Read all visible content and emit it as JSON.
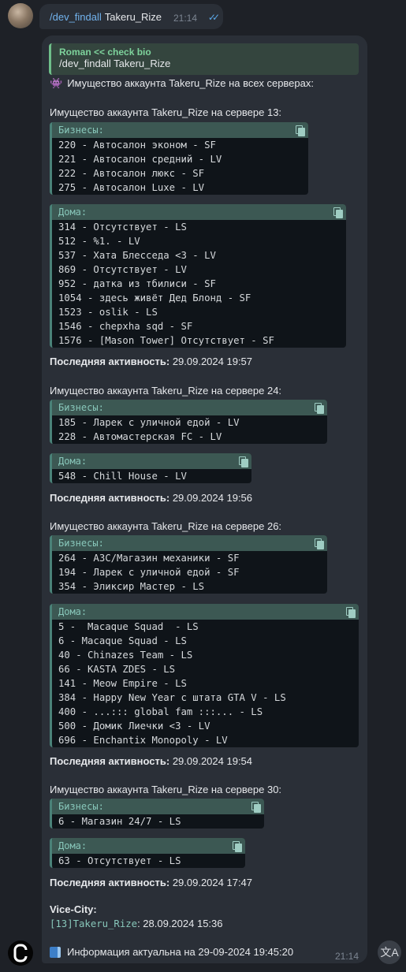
{
  "command": {
    "link": "/dev_findall",
    "arg": "Takeru_Rize",
    "time": "21:14",
    "ticks": "✓✓"
  },
  "reply": {
    "author": "Roman << check bio",
    "text": "/dev_findall Takeru_Rize"
  },
  "header": {
    "icon": "👾",
    "text": "Имущество аккаунта Takeru_Rize на всех серверах:"
  },
  "servers": [
    {
      "title": "Имущество аккаунта Takeru_Rize на сервере 13:",
      "business_label": "Бизнесы:",
      "businesses": [
        "220 - Автосалон эконом - SF",
        "221 - Автосалон средний - LV",
        "222 - Автосалон люкс - SF",
        "275 - Автосалон Luxe - LV"
      ],
      "homes_label": "Дома:",
      "homes": [
        "314 - Отсутствует - LS",
        "512 - %1. - LV",
        "537 - Хата Блесседа <3 - LV",
        "869 - Отсутствует - LV",
        "952 - датка из тбилиси - SF",
        "1054 - здесь живёт Дед Блонд - SF",
        "1523 - oslik - LS",
        "1546 - chepxha sqd - SF",
        "1576 - [Mason Tower] Отсутствует - SF"
      ],
      "activity_label": "Последняя активность:",
      "activity": "29.09.2024 19:57"
    },
    {
      "title": "Имущество аккаунта Takeru_Rize на сервере 24:",
      "business_label": "Бизнесы:",
      "businesses": [
        "185 - Ларек с уличной едой - LV",
        "228 - Автомастерская FC - LV"
      ],
      "homes_label": "Дома:",
      "homes": [
        "548 - Chill House - LV"
      ],
      "activity_label": "Последняя активность:",
      "activity": "29.09.2024 19:56"
    },
    {
      "title": "Имущество аккаунта Takeru_Rize на сервере 26:",
      "business_label": "Бизнесы:",
      "businesses": [
        "264 - АЗС/Магазин механики - SF",
        "194 - Ларек с уличной едой - SF",
        "354 - Эликсир Мастер - LS"
      ],
      "homes_label": "Дома:",
      "homes": [
        "5 -  Macaque Squad  - LS",
        "6 - Macaque Squad - LS",
        "40 - Chinazes Team - LS",
        "66 - KASTA ZDES - LS",
        "141 - Meow Empire - LS",
        "384 - Happy New Year с штата GTA V - LS",
        "400 - ...::: global fam :::... - LS",
        "500 - Домик Лиечки <3 - LV",
        "696 - Enchantix Monopoly - LV"
      ],
      "activity_label": "Последняя активность:",
      "activity": "29.09.2024 19:54"
    },
    {
      "title": "Имущество аккаунта Takeru_Rize на сервере 30:",
      "business_label": "Бизнесы:",
      "businesses": [
        "6 - Магазин 24/7 - LS"
      ],
      "homes_label": "Дома:",
      "homes": [
        "63 - Отсутствует - LS"
      ],
      "activity_label": "Последняя активность:",
      "activity": "29.09.2024 17:47"
    }
  ],
  "vice_city": {
    "title": "Vice-City:",
    "account": "[13]Takeru_Rize",
    "date": ": 28.09.2024 15:36"
  },
  "info": {
    "text": "Информация актуальна на 29-09-2024 19:45:20",
    "time": "21:14"
  }
}
